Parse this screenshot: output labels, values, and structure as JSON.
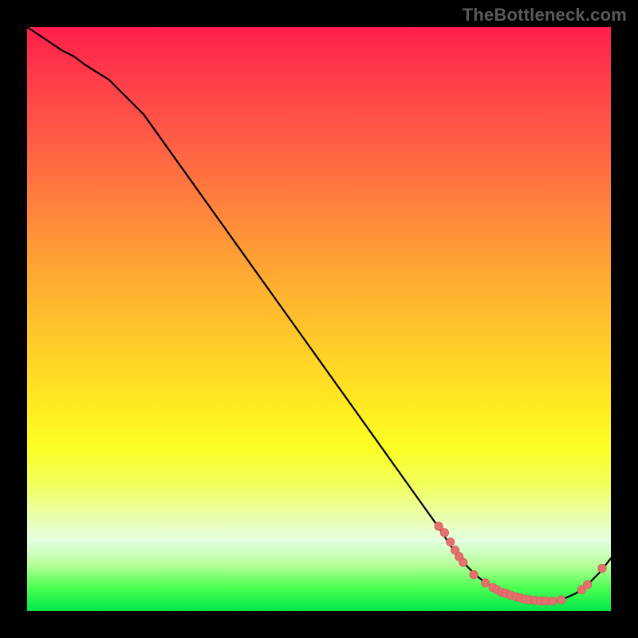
{
  "watermark": "TheBottleneck.com",
  "colors": {
    "line": "#000000",
    "marker": "#e4716f",
    "marker_stroke": "#d85a58"
  },
  "chart_data": {
    "type": "line",
    "title": "",
    "xlabel": "",
    "ylabel": "",
    "xlim": [
      0,
      100
    ],
    "ylim": [
      0,
      100
    ],
    "background_gradient": "thermal-red-to-green-vertical",
    "series": [
      {
        "name": "bottleneck-curve",
        "x": [
          0,
          3,
          6,
          8,
          10,
          14,
          20,
          30,
          40,
          50,
          60,
          65,
          70,
          73,
          75,
          77,
          79,
          81,
          83,
          85,
          87,
          88,
          89,
          90,
          91,
          92,
          94,
          96,
          98,
          100
        ],
        "y": [
          100,
          98,
          96,
          95,
          93.5,
          91,
          85,
          71,
          57,
          43,
          29,
          22,
          15,
          10.5,
          8,
          6,
          4.5,
          3.4,
          2.6,
          2.1,
          1.8,
          1.7,
          1.7,
          1.7,
          1.8,
          2.1,
          3.0,
          4.5,
          6.5,
          9
        ]
      }
    ],
    "markers": [
      {
        "x": 70.5,
        "y": 14.5
      },
      {
        "x": 71.5,
        "y": 13.4
      },
      {
        "x": 72.5,
        "y": 11.8
      },
      {
        "x": 73.3,
        "y": 10.4
      },
      {
        "x": 74.0,
        "y": 9.3
      },
      {
        "x": 74.7,
        "y": 8.3
      },
      {
        "x": 76.5,
        "y": 6.2
      },
      {
        "x": 78.5,
        "y": 4.8
      },
      {
        "x": 79.8,
        "y": 4.0
      },
      {
        "x": 80.5,
        "y": 3.6
      },
      {
        "x": 81.3,
        "y": 3.2
      },
      {
        "x": 82.0,
        "y": 3.0
      },
      {
        "x": 82.8,
        "y": 2.7
      },
      {
        "x": 83.8,
        "y": 2.4
      },
      {
        "x": 84.5,
        "y": 2.2
      },
      {
        "x": 85.3,
        "y": 2.0
      },
      {
        "x": 86.0,
        "y": 1.9
      },
      {
        "x": 87.0,
        "y": 1.8
      },
      {
        "x": 88.0,
        "y": 1.7
      },
      {
        "x": 88.8,
        "y": 1.7
      },
      {
        "x": 90.0,
        "y": 1.7
      },
      {
        "x": 91.5,
        "y": 1.9
      },
      {
        "x": 95.0,
        "y": 3.6
      },
      {
        "x": 96.0,
        "y": 4.5
      },
      {
        "x": 98.5,
        "y": 7.3
      }
    ]
  }
}
